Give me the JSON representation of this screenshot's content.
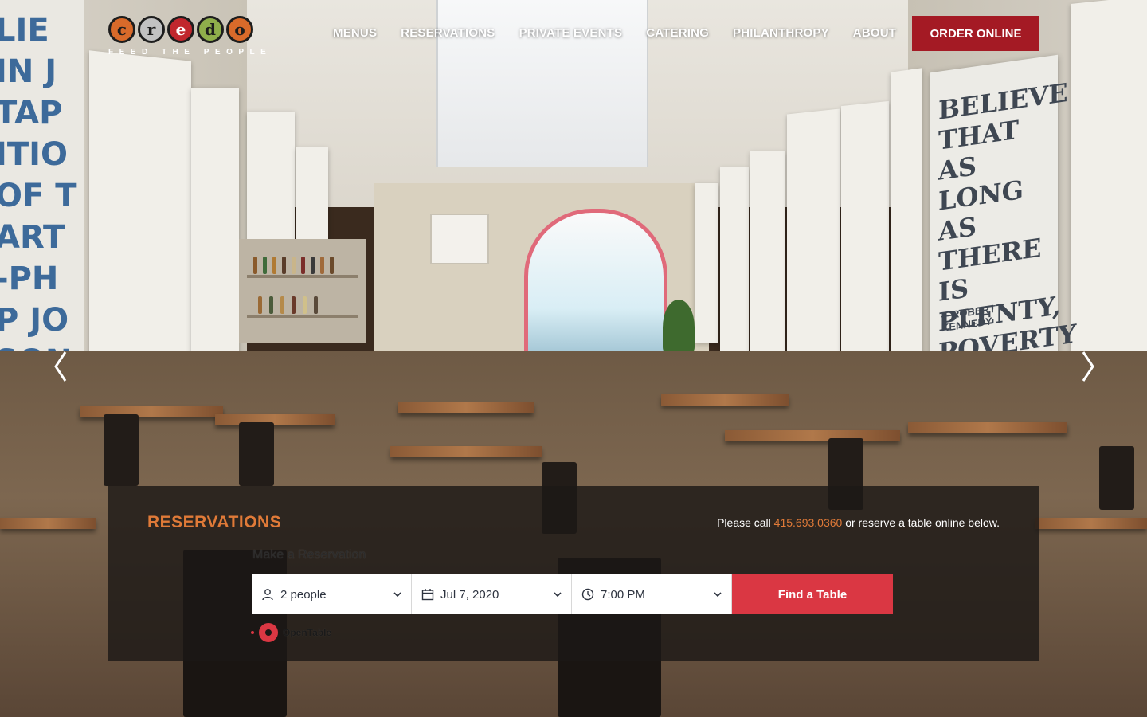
{
  "brand": {
    "logo_letters": [
      "c",
      "r",
      "e",
      "d",
      "o"
    ],
    "logo_colors": [
      "#d86a2a",
      "#c2c2c2",
      "#c1272d",
      "#8fae4b",
      "#d86a2a"
    ],
    "tagline": "FEED THE PEOPLE"
  },
  "nav": {
    "items": [
      {
        "label": "MENUS"
      },
      {
        "label": "RESERVATIONS"
      },
      {
        "label": "PRIVATE EVENTS"
      },
      {
        "label": "CATERING"
      },
      {
        "label": "PHILANTHROPY"
      },
      {
        "label": "ABOUT"
      }
    ],
    "order_label": "ORDER ONLINE"
  },
  "hero": {
    "right_quote": "BELIEVE THAT AS LONG AS THERE IS PLENTY, POVERTY IS EVIL",
    "right_quote_author": "—ROBERT F. KENNEDY",
    "left_quote": "LIE IN J TAP ITIO OF T ART -PH P JO SON",
    "arrow_left_icon": "chevron-left-icon",
    "arrow_right_icon": "chevron-right-icon"
  },
  "reservations": {
    "title": "RESERVATIONS",
    "call_prefix": "Please call ",
    "phone": "415.693.0360",
    "call_suffix": " or reserve a table online below.",
    "subtitle": "Make a Reservation",
    "party": "2 people",
    "date": "Jul 7, 2020",
    "time": "7:00 PM",
    "find_label": "Find a Table",
    "provider": "OpenTable",
    "colors": {
      "accent": "#e07a38",
      "button": "#da3743"
    }
  }
}
